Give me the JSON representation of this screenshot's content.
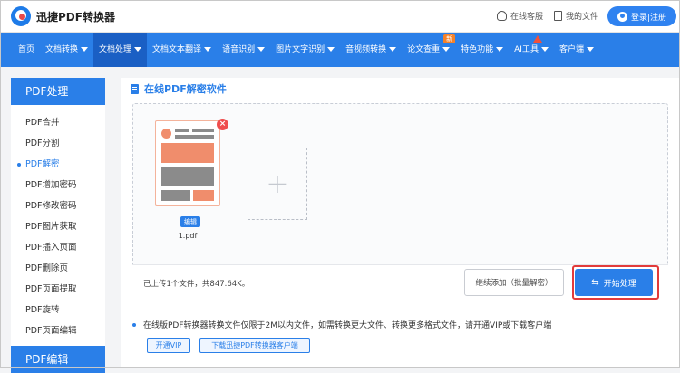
{
  "header": {
    "logo_text": "迅捷PDF转换器",
    "service_label": "在线客服",
    "myfiles_label": "我的文件",
    "login_label": "登录|注册"
  },
  "nav": {
    "items": [
      {
        "label": "首页"
      },
      {
        "label": "文档转换"
      },
      {
        "label": "文档处理"
      },
      {
        "label": "文档文本翻译"
      },
      {
        "label": "语音识别"
      },
      {
        "label": "图片文字识别"
      },
      {
        "label": "音视频转换"
      },
      {
        "label": "论文查重"
      },
      {
        "label": "特色功能"
      },
      {
        "label": "AI工具"
      },
      {
        "label": "客户端"
      }
    ],
    "new_badge": "新"
  },
  "sidebar": {
    "title": "PDF处理",
    "items": [
      {
        "label": "PDF合并"
      },
      {
        "label": "PDF分割"
      },
      {
        "label": "PDF解密"
      },
      {
        "label": "PDF增加密码"
      },
      {
        "label": "PDF修改密码"
      },
      {
        "label": "PDF图片获取"
      },
      {
        "label": "PDF插入页面"
      },
      {
        "label": "PDF删除页"
      },
      {
        "label": "PDF页面提取"
      },
      {
        "label": "PDF旋转"
      },
      {
        "label": "PDF页面编辑"
      }
    ],
    "title2": "PDF编辑"
  },
  "main": {
    "title": "在线PDF解密软件",
    "file": {
      "edit_tag": "编辑",
      "name": "1.pdf",
      "close": "×"
    },
    "add_symbol": "+",
    "count_text": "已上传1个文件，共847.64K。",
    "continue_label": "继续添加（批量解密）",
    "start_label": "开始处理",
    "notice": "在线版PDF转换器转换文件仅限于2M以内文件，如需转换更大文件、转换更多格式文件，请开通VIP或下载客户端",
    "vip_label": "开通VIP",
    "download_label": "下载迅捷PDF转换器客户端"
  },
  "colors": {
    "primary": "#2a7fe8",
    "highlight": "#e23b3b",
    "thumb_accent": "#f08d6c"
  }
}
